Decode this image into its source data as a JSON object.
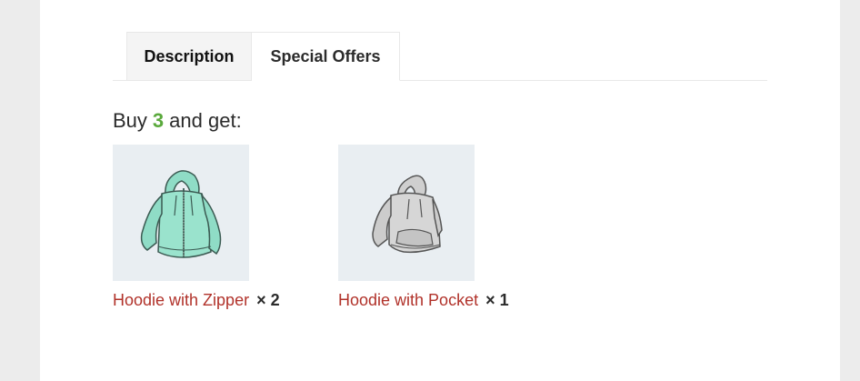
{
  "tabs": [
    {
      "label": "Description"
    },
    {
      "label": "Special Offers"
    }
  ],
  "offer": {
    "prefix": "Buy",
    "quantity": "3",
    "suffix": "and get:"
  },
  "products": [
    {
      "name": "Hoodie with Zipper",
      "multiplier": "× 2",
      "image": "teal-zip-hoodie"
    },
    {
      "name": "Hoodie with Pocket",
      "multiplier": "× 1",
      "image": "grey-pocket-hoodie"
    }
  ],
  "colors": {
    "quantity": "#5aa93c",
    "product_link": "#b1322a",
    "thumb_bg": "#e9eef2"
  }
}
